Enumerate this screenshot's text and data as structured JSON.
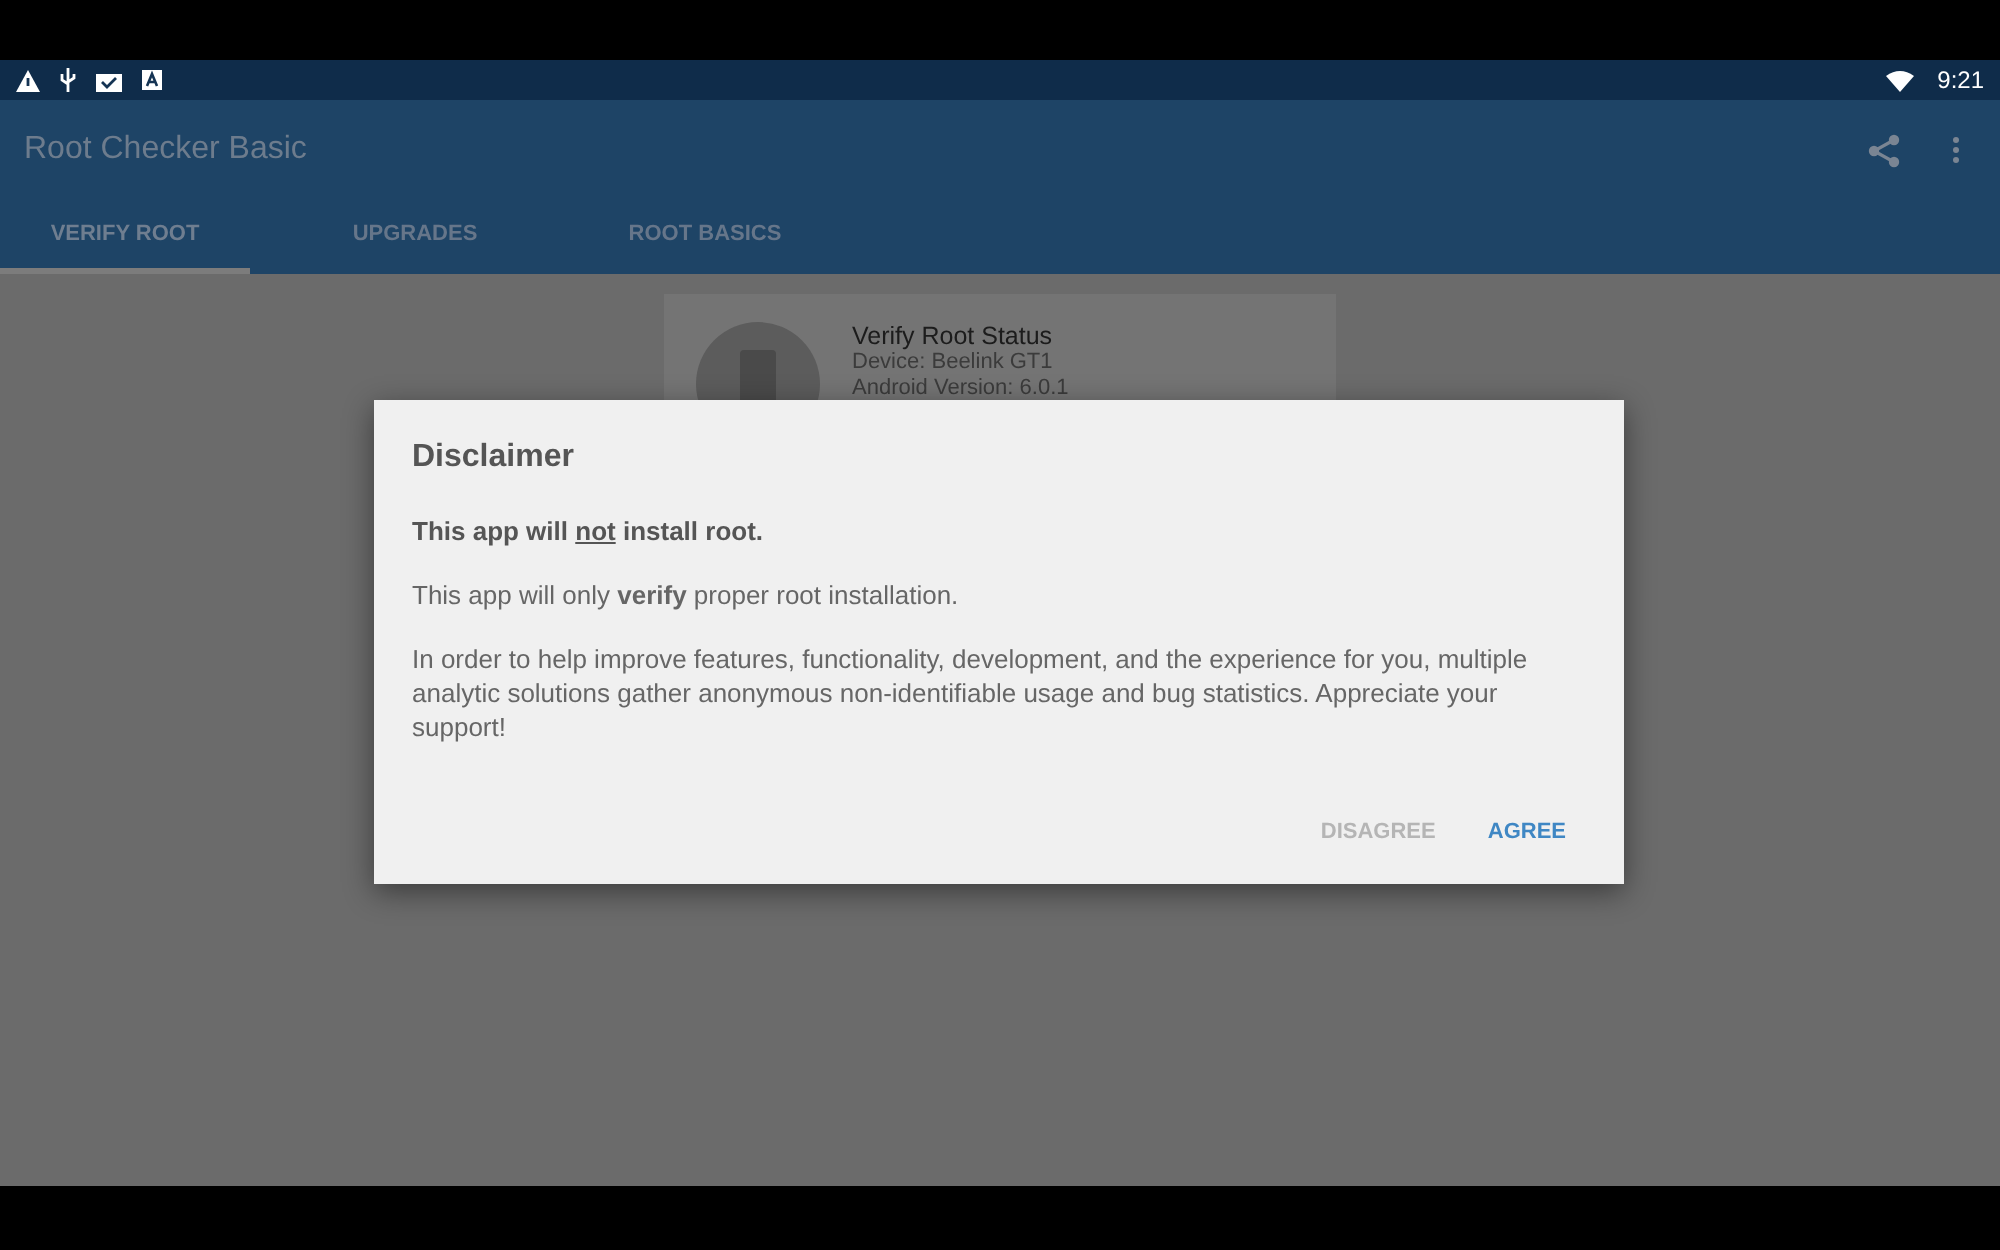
{
  "status_bar": {
    "time": "9:21"
  },
  "app_bar": {
    "title": "Root Checker Basic"
  },
  "tabs": [
    {
      "label": "VERIFY ROOT",
      "selected": true
    },
    {
      "label": "UPGRADES",
      "selected": false
    },
    {
      "label": "ROOT BASICS",
      "selected": false
    }
  ],
  "status_card": {
    "title": "Verify Root Status",
    "lines": [
      "Device: Beelink GT1",
      "Android Version: 6.0.1"
    ]
  },
  "dialog": {
    "title": "Disclaimer",
    "warning": {
      "before": "This app will ",
      "emphasis": "not",
      "after": " install root."
    },
    "paragraphs": [
      "This app will only **verify** proper root installation.",
      "In order to help improve features, functionality, development, and the experience for you, multiple analytic solutions gather anonymous non-identifiable usage and bug statistics. Appreciate your support!"
    ],
    "buttons": [
      {
        "label": "DISAGREE",
        "kind": "secondary"
      },
      {
        "label": "AGREE",
        "kind": "primary"
      }
    ]
  }
}
